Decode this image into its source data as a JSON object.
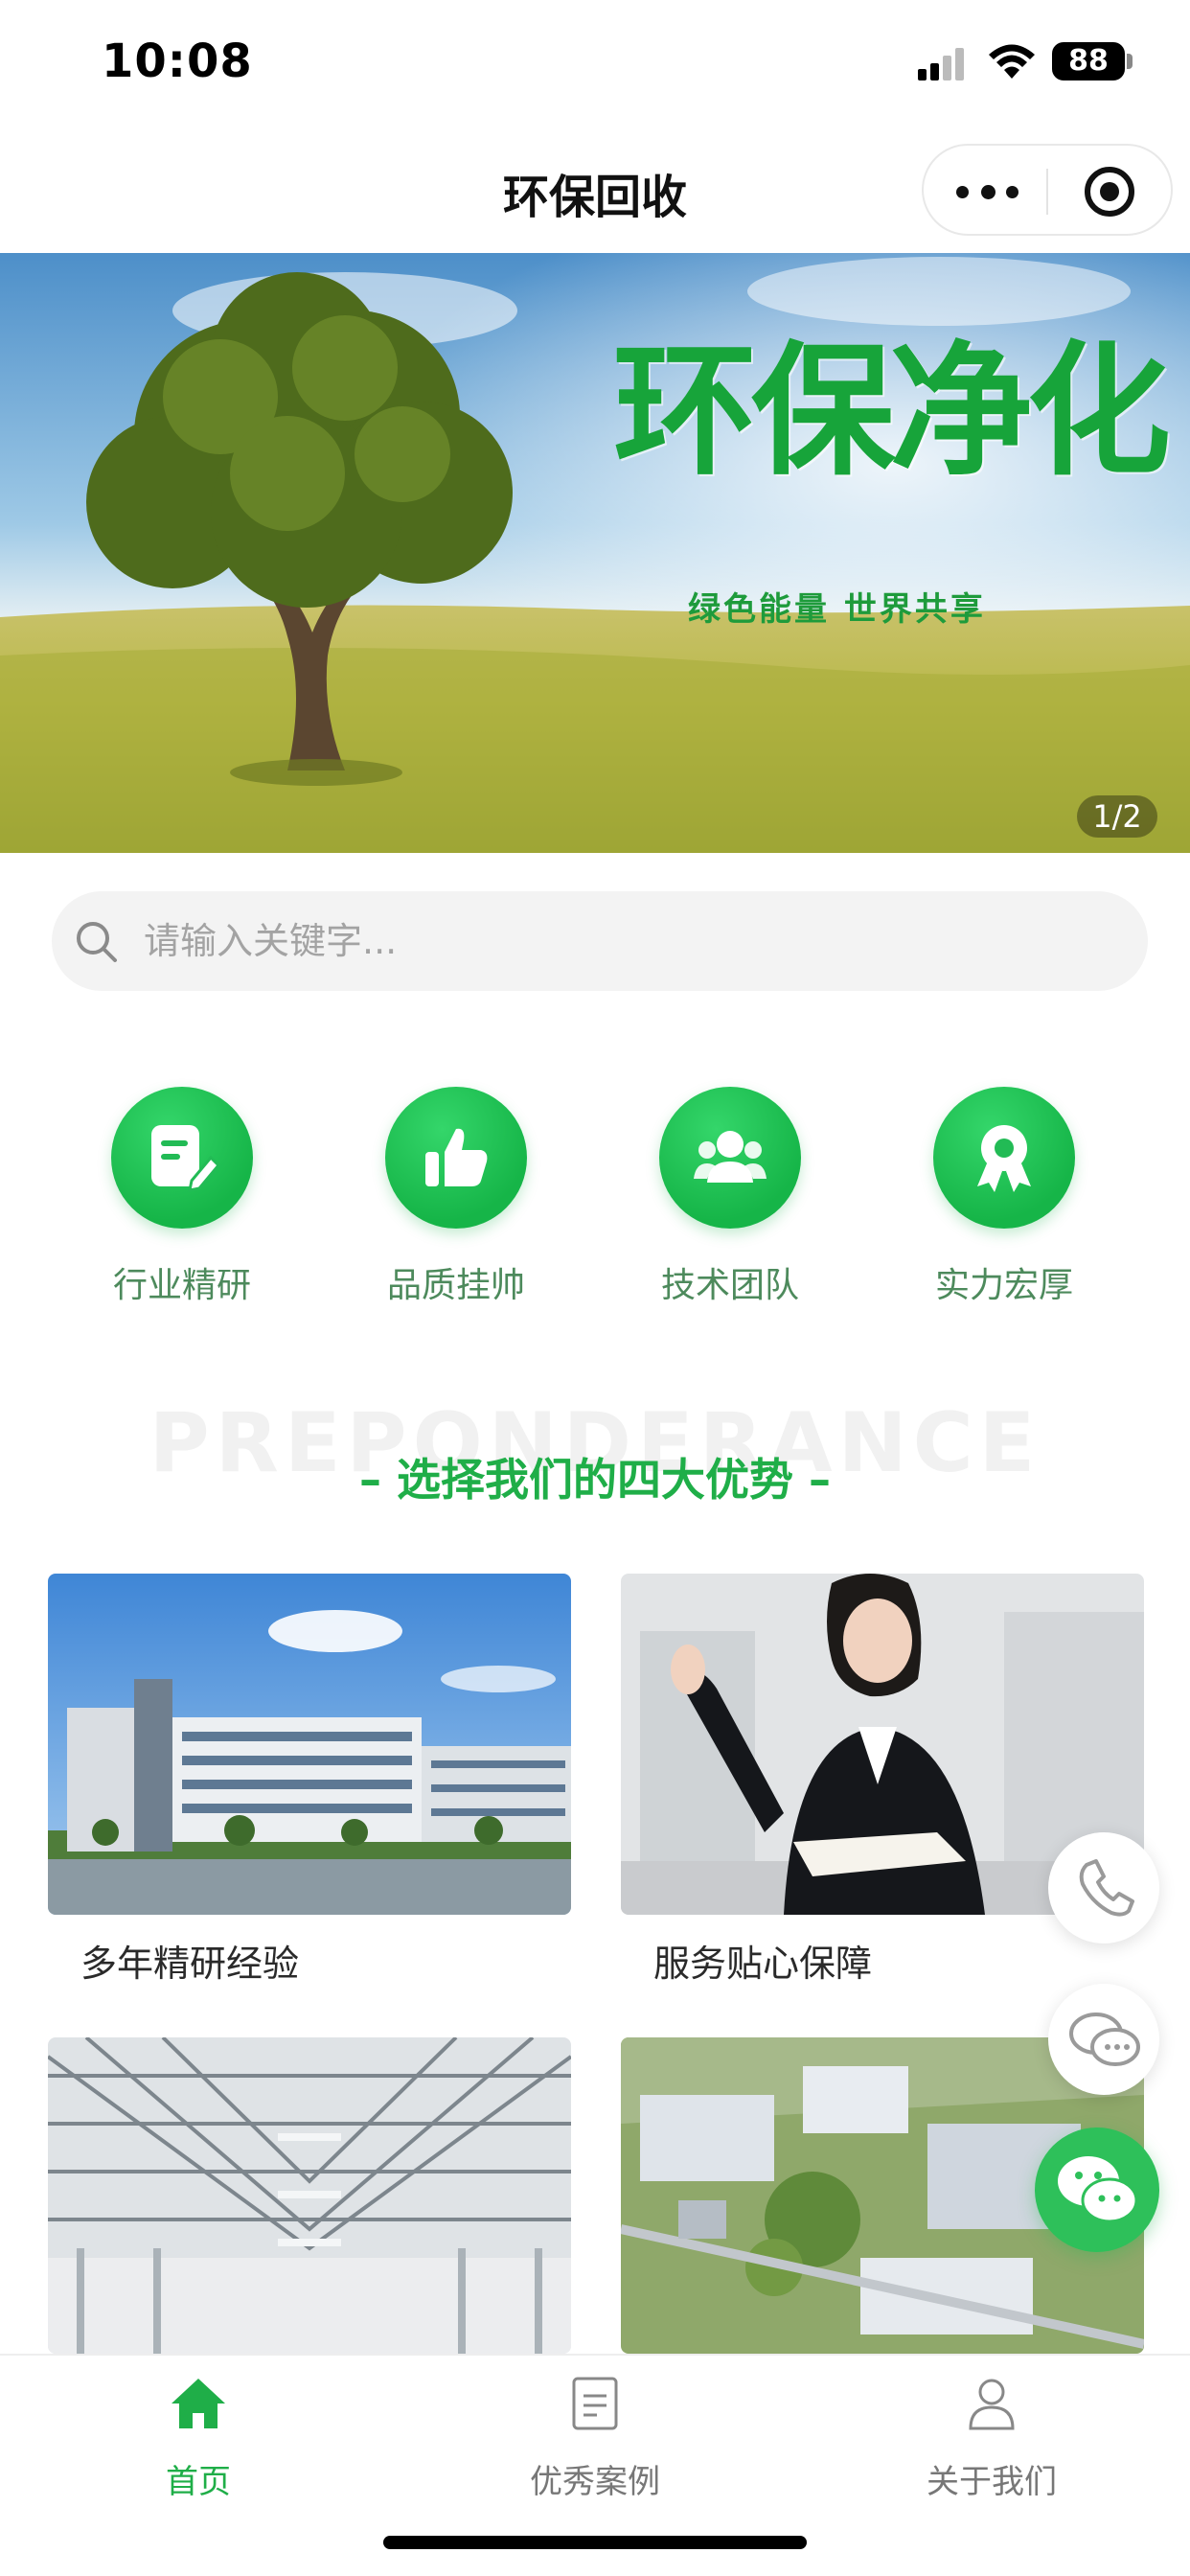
{
  "status_bar": {
    "time": "10:08",
    "battery": "88"
  },
  "nav": {
    "title": "环保回收"
  },
  "banner": {
    "title": "环保净化",
    "subtitle": "绿色能量 世界共享",
    "indicator": "1/2"
  },
  "search": {
    "placeholder": "请输入关键字..."
  },
  "features": [
    {
      "label": "行业精研",
      "icon": "document-edit-icon"
    },
    {
      "label": "品质挂帅",
      "icon": "thumbs-up-icon"
    },
    {
      "label": "技术团队",
      "icon": "team-icon"
    },
    {
      "label": "实力宏厚",
      "icon": "award-ribbon-icon"
    }
  ],
  "section": {
    "bg_text": "PREPONDERANCE",
    "title": "– 选择我们的四大优势 –"
  },
  "cards": [
    {
      "title": "多年精研经验"
    },
    {
      "title": "服务贴心保障"
    }
  ],
  "tab_bar": {
    "items": [
      {
        "label": "首页",
        "icon": "home-icon",
        "active": true
      },
      {
        "label": "优秀案例",
        "icon": "document-list-icon",
        "active": false
      },
      {
        "label": "关于我们",
        "icon": "user-icon",
        "active": false
      }
    ]
  },
  "colors": {
    "brand_green": "#1fae48",
    "accent_green": "#2ec05a"
  }
}
